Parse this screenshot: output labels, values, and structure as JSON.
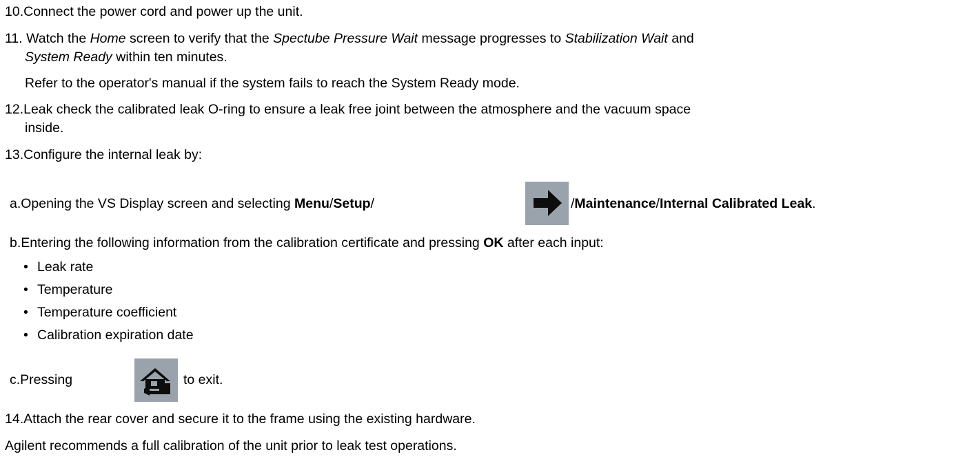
{
  "steps": {
    "s10": {
      "num": "10.",
      "text": "Connect the power cord and power up the unit."
    },
    "s11": {
      "num": "11.",
      "p1": "Watch the ",
      "home": "Home",
      "p2": " screen to verify that the ",
      "spectube": "Spectube Pressure Wait",
      "p3": " message progresses to ",
      "stab": "Stabilization Wait",
      "p4": " and",
      "sysready": "System Ready",
      "p5": " within ten minutes.",
      "note": "Refer to the operator's manual if the system fails to reach the System Ready mode."
    },
    "s12": {
      "num": "12.",
      "line1": "Leak check the calibrated leak O-ring to ensure a leak free joint between the atmosphere and the vacuum space",
      "line2": "inside."
    },
    "s13": {
      "num": "13.",
      "text": "Configure the internal leak by:",
      "a": {
        "label": "a.",
        "p1": "Opening the VS Display screen and selecting ",
        "menu": "Menu",
        "sep1": "/",
        "setup": "Setup",
        "sep2": "/",
        "sep3": "/",
        "maint": "Maintenance",
        "sep4": "/",
        "icl": "Internal Calibrated Leak",
        "end": "."
      },
      "b": {
        "label": "b.",
        "p1": "Entering the following information from the calibration certificate and pressing ",
        "ok": "OK",
        "p2": " after each input:",
        "items": [
          "Leak rate",
          "Temperature",
          "Temperature coefficient",
          "Calibration expiration date"
        ]
      },
      "c": {
        "label": "c.",
        "p1": "Pressing",
        "p2": "to exit."
      }
    },
    "s14": {
      "num": "14.",
      "text": "Attach the rear cover and secure it to the frame using the existing hardware."
    }
  },
  "footer_note": "Agilent recommends a full calibration of the unit prior to leak test operations.",
  "icons": {
    "arrow": "right-arrow-icon",
    "home": "home-icon",
    "icon_bg": "#9aa3ab"
  }
}
